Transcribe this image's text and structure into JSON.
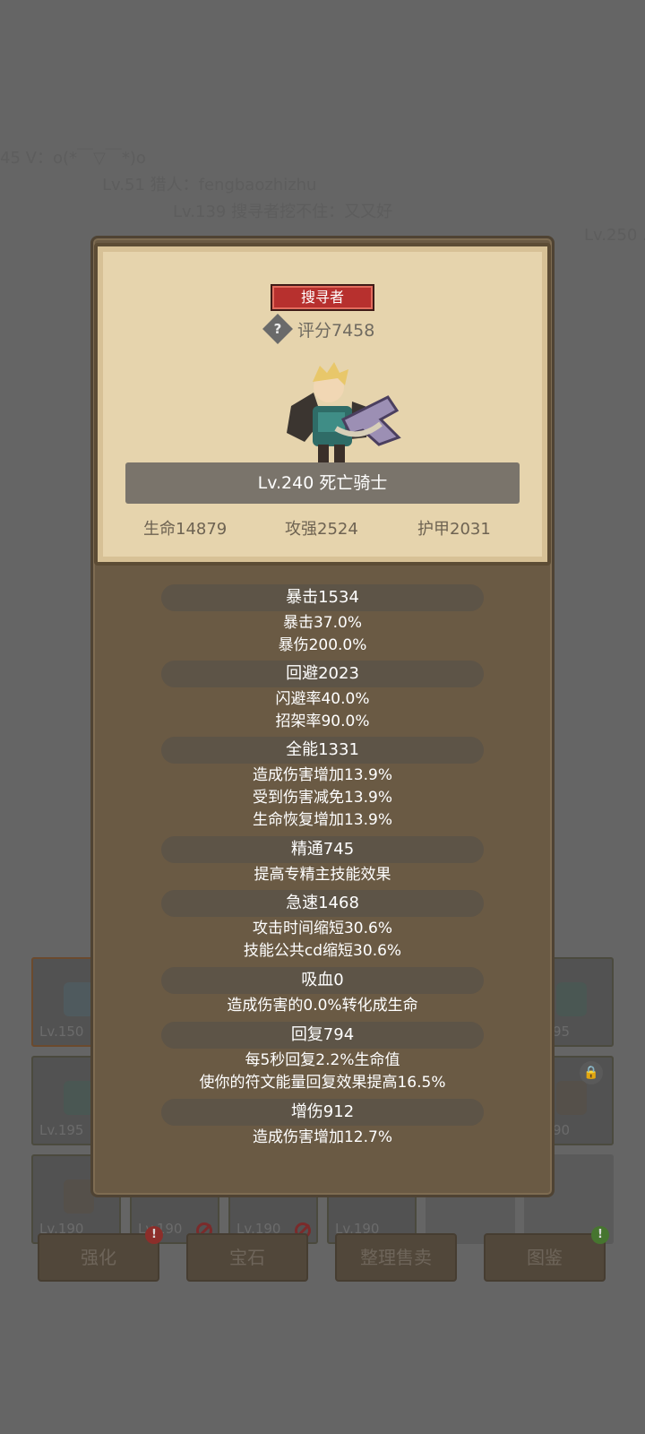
{
  "chat": [
    "45 V：o(*￣▽￣*)o",
    "Lv.51 猎人：fengbaozhizhu",
    "Lv.139 搜寻者挖不住：又又好",
    "Lv.250 ."
  ],
  "inventory": {
    "slots": [
      {
        "level": "Lv.150"
      },
      {
        "level": "95"
      },
      {
        "level": "Lv.195"
      },
      {
        "level": "90"
      },
      {
        "level": "Lv.190"
      },
      {
        "level": "Lv.190"
      },
      {
        "level": "Lv.190"
      },
      {
        "level": "Lv.190"
      }
    ],
    "buttons": [
      {
        "label": "强化",
        "badge": "!"
      },
      {
        "label": "宝石"
      },
      {
        "label": "整理售卖"
      },
      {
        "label": "图鉴",
        "badge": "!"
      }
    ]
  },
  "profile": {
    "class_badge": "搜寻者",
    "score": "评分7458",
    "name": "Lv.240 死亡骑士",
    "core": {
      "hp": "生命14879",
      "atk": "攻强2524",
      "armor": "护甲2031"
    }
  },
  "stats": [
    {
      "title": "暴击1534",
      "lines": [
        "暴击37.0%",
        "暴伤200.0%"
      ]
    },
    {
      "title": "回避2023",
      "lines": [
        "闪避率40.0%",
        "招架率90.0%"
      ]
    },
    {
      "title": "全能1331",
      "lines": [
        "造成伤害增加13.9%",
        "受到伤害减免13.9%",
        "生命恢复增加13.9%"
      ]
    },
    {
      "title": "精通745",
      "lines": [
        "提高专精主技能效果"
      ]
    },
    {
      "title": "急速1468",
      "lines": [
        "攻击时间缩短30.6%",
        "技能公共cd缩短30.6%"
      ]
    },
    {
      "title": "吸血0",
      "lines": [
        "造成伤害的0.0%转化成生命"
      ]
    },
    {
      "title": "回复794",
      "lines": [
        "每5秒回复2.2%生命值",
        "使你的符文能量回复效果提高16.5%"
      ]
    },
    {
      "title": "增伤912",
      "lines": [
        "造成伤害增加12.7%"
      ]
    }
  ]
}
